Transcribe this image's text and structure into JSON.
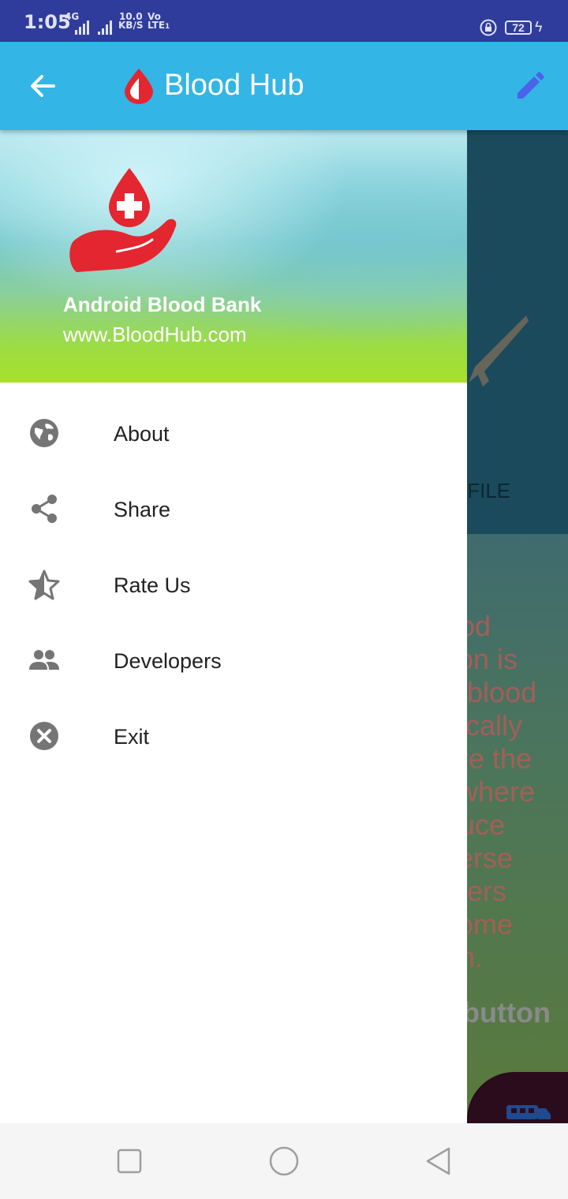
{
  "status_bar": {
    "time": "1:05",
    "network_type": "4G",
    "data_speed_value": "10.0",
    "data_speed_unit": "KB/S",
    "volte_top": "Vo",
    "volte_bottom": "LTE",
    "volte_sim": "1",
    "battery": "72"
  },
  "app_bar": {
    "title": "Blood Hub",
    "back_icon": "arrow-left-icon",
    "edit_icon": "pencil-icon",
    "logo_icon": "blood-drop-logo"
  },
  "drawer": {
    "header": {
      "app_name": "Android Blood Bank",
      "website": "www.BloodHub.com",
      "logo_icon": "blood-drop-hand-logo"
    },
    "items": [
      {
        "label": "About",
        "icon": "globe-icon"
      },
      {
        "label": "Share",
        "icon": "share-icon"
      },
      {
        "label": "Rate Us",
        "icon": "star-icon"
      },
      {
        "label": "Developers",
        "icon": "people-icon"
      },
      {
        "label": "Exit",
        "icon": "close-circle-icon"
      }
    ]
  },
  "background": {
    "tab_partial": "OFILE",
    "paragraph_partial": "ood\ntion is\nn blood\npically\nere the\nl where\nduce\nverse\nefers\nsome\non.",
    "button_partial": "button"
  },
  "colors": {
    "status_bar": "#2f3c9b",
    "app_bar": "#33b5e5",
    "blood_red": "#e3262f",
    "edit_icon": "#4a63e8",
    "menu_icon": "#757575"
  },
  "nav_bar": {
    "recent_icon": "square-icon",
    "home_icon": "circle-icon",
    "back_icon": "triangle-back-icon"
  }
}
